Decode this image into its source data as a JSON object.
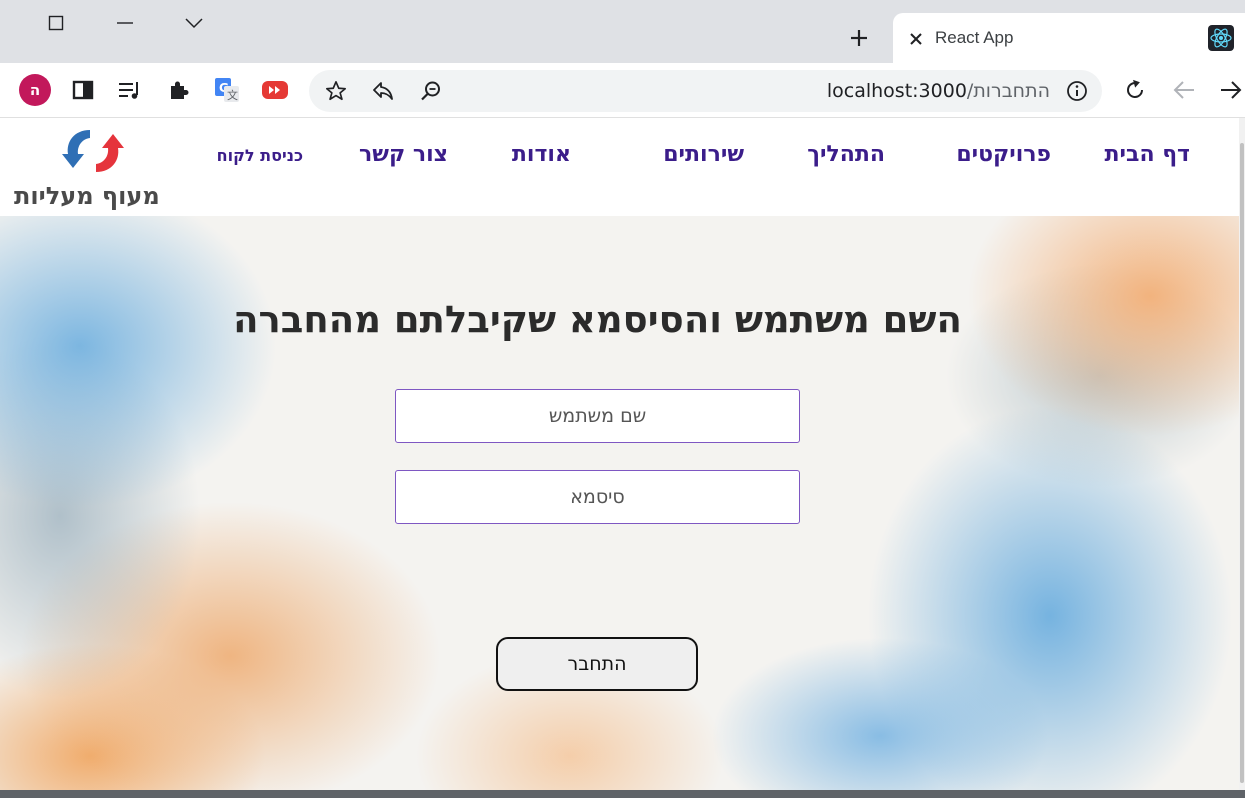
{
  "browser": {
    "tab": {
      "title": "React App",
      "favicon": "react-icon"
    },
    "window_controls": [
      "maximize-icon",
      "minimize-icon",
      "tab-search-icon"
    ],
    "new_tab_icon": "plus-icon",
    "profile_initial": "ה",
    "profile_color": "#c2185b",
    "extensions": [
      "reading-list-icon",
      "sidebar-icon",
      "media-playlist-icon",
      "puzzle-icon",
      "google-translate-icon",
      "youtube-icon"
    ],
    "address": {
      "host": "localhost:3000",
      "path": "/התחברות"
    },
    "nav": [
      "reload-icon",
      "back-icon",
      "forward-icon"
    ]
  },
  "site": {
    "logo_text": "מעוף מעליות",
    "nav": {
      "home": "דף הבית",
      "projects": "פרויקטים",
      "process": "התהליך",
      "services": "שירותים",
      "about": "אודות",
      "contact": "צור קשר",
      "client_login": "כניסת לקוח"
    },
    "nav_color": "#3b1d8a"
  },
  "login": {
    "title": "השם משתמש והסיסמא שקיבלתם מהחברה",
    "username_placeholder": "שם משתמש",
    "password_placeholder": "סיסמא",
    "submit_label": "התחבר",
    "field_border_color": "#7e57c2"
  }
}
